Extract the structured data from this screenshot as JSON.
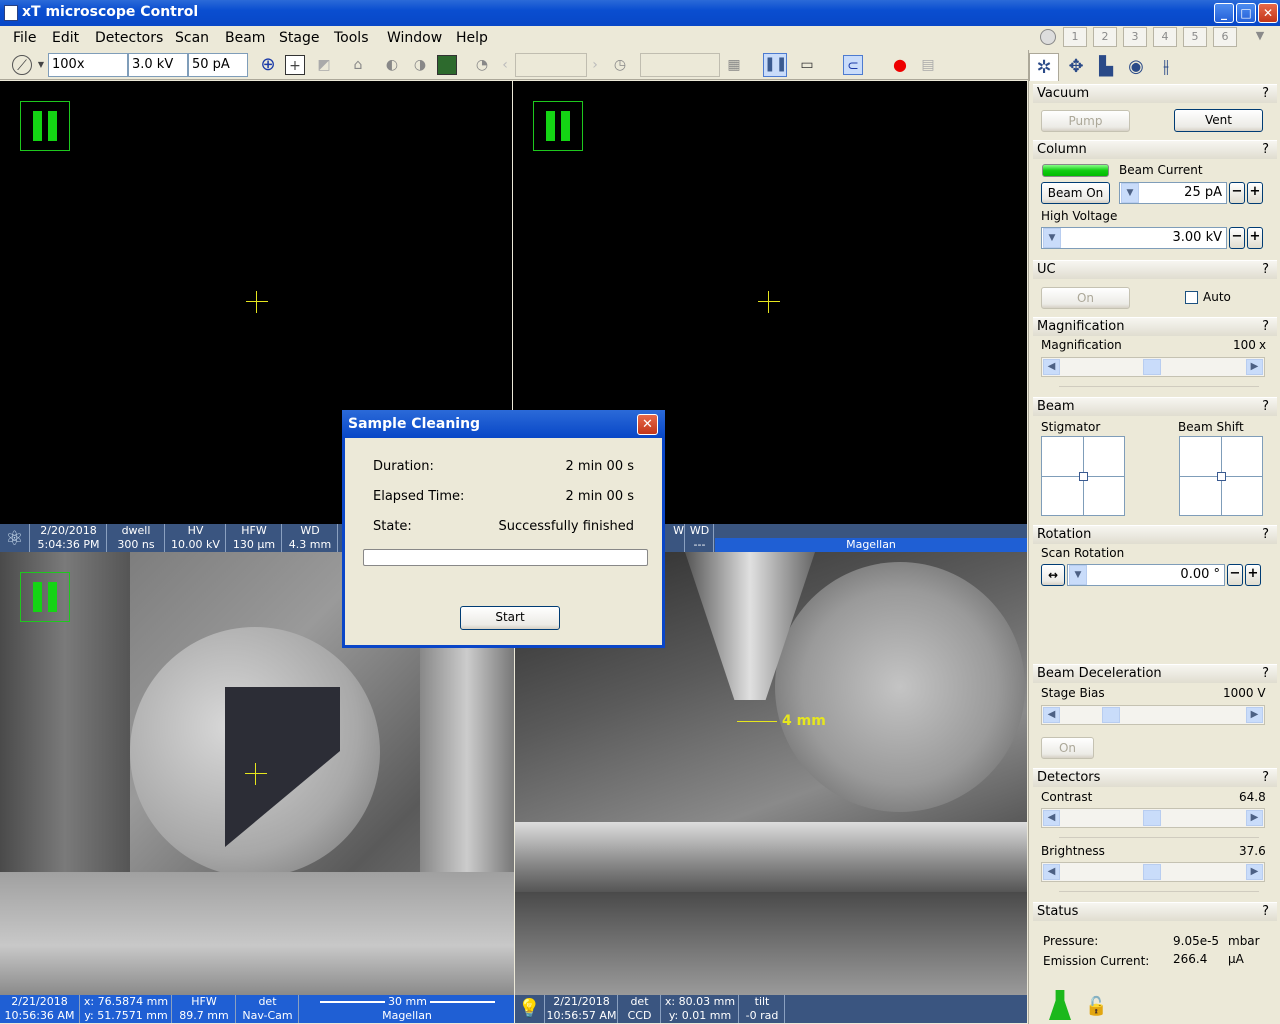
{
  "window": {
    "title": "xT microscope Control"
  },
  "menu": [
    "File",
    "Edit",
    "Detectors",
    "Scan",
    "Beam",
    "Stage",
    "Tools",
    "Window",
    "Help"
  ],
  "tabs": [
    "1",
    "2",
    "3",
    "4",
    "5",
    "6"
  ],
  "toolbar": {
    "magnification": "100x",
    "voltage": "3.0 kV",
    "current": "50 pA"
  },
  "quad1": {
    "date": "2/20/2018",
    "time": "5:04:36 PM",
    "c1h": "dwell",
    "c1v": "300 ns",
    "c2h": "HV",
    "c2v": "10.00 kV",
    "c3h": "HFW",
    "c3v": "130 µm",
    "c4h": "WD",
    "c4v": "4.3 mm"
  },
  "quad2": {
    "c1h": "W",
    "c2h": "WD",
    "c2v": "---",
    "label": "Magellan"
  },
  "quad3": {
    "date": "2/21/2018",
    "time": "10:56:36 AM",
    "x": "x: 76.5874 mm",
    "y": "y: 51.7571 mm",
    "hfwh": "HFW",
    "hfwv": "89.7 mm",
    "deth": "det",
    "detv": "Nav-Cam",
    "scale": "30 mm",
    "label": "Magellan"
  },
  "quad4": {
    "date": "2/21/2018",
    "time": "10:56:57 AM",
    "deth": "det",
    "detv": "CCD",
    "x": "x: 80.03 mm",
    "y": "y: 0.01 mm",
    "tilth": "tilt",
    "tiltv": "-0 rad",
    "scale": "4 mm"
  },
  "dialog": {
    "title": "Sample Cleaning",
    "duration_label": "Duration:",
    "duration": "2 min 00 s",
    "elapsed_label": "Elapsed Time:",
    "elapsed": "2 min 00 s",
    "state_label": "State:",
    "state": "Successfully finished",
    "progress": 0,
    "start": "Start"
  },
  "panel": {
    "vacuum": {
      "title": "Vacuum",
      "pump": "Pump",
      "vent": "Vent"
    },
    "column": {
      "title": "Column",
      "beam_current_label": "Beam Current",
      "beam_on": "Beam On",
      "beam_current": "25 pA",
      "hv_label": "High Voltage",
      "hv": "3.00 kV"
    },
    "uc": {
      "title": "UC",
      "on": "On",
      "auto": "Auto"
    },
    "magnification": {
      "title": "Magnification",
      "label": "Magnification",
      "value": "100",
      "unit": "x"
    },
    "beam": {
      "title": "Beam",
      "stigmator": "Stigmator",
      "shift": "Beam Shift"
    },
    "rotation": {
      "title": "Rotation",
      "label": "Scan Rotation",
      "value": "0.00 °"
    },
    "decel": {
      "title": "Beam Deceleration",
      "label": "Stage Bias",
      "value": "1000 V",
      "on": "On"
    },
    "detectors": {
      "title": "Detectors",
      "contrast_label": "Contrast",
      "contrast": "64.8",
      "brightness_label": "Brightness",
      "brightness": "37.6"
    },
    "status": {
      "title": "Status",
      "pressure_label": "Pressure:",
      "pressure": "9.05e-5",
      "pressure_unit": "mbar",
      "emission_label": "Emission Current:",
      "emission": "266.4",
      "emission_unit": "µA"
    },
    "help": "?"
  },
  "colors": {
    "accent": "#0a4ed0",
    "status_ok": "#14d414",
    "crosshair": "#e6e61e"
  }
}
